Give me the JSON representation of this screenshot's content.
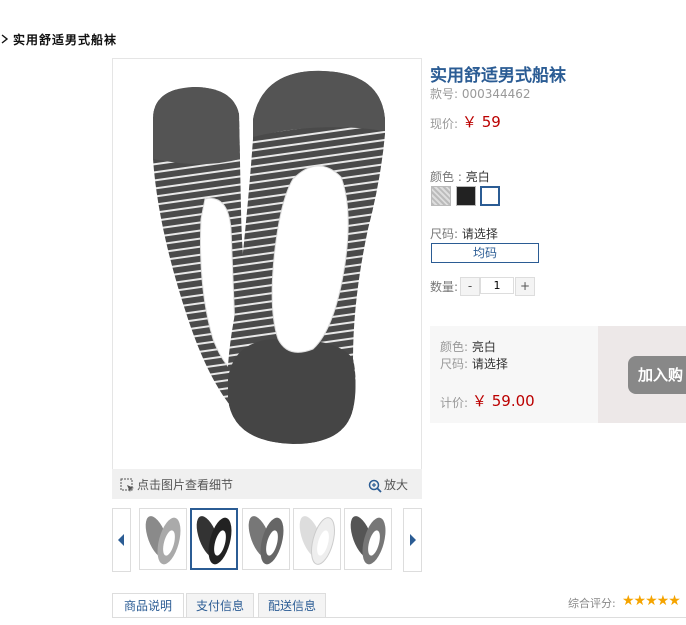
{
  "breadcrumb": {
    "title": "实用舒适男式船袜"
  },
  "gallery": {
    "detail_hint": "点击图片查看细节",
    "zoom_label": "放大",
    "thumbnails": [
      "thumb-1",
      "thumb-2",
      "thumb-3",
      "thumb-4",
      "thumb-5"
    ],
    "selected_thumbnail": 2
  },
  "product": {
    "title": "实用舒适男式船袜",
    "sku": "款号: 000344462",
    "price_label": "现价:",
    "price": "￥ 59",
    "color_label": "颜色 :",
    "color_value": "亮白",
    "colors": [
      "#bdbdbd",
      "#222222",
      "#ffffff"
    ],
    "size_label": "尺码:",
    "size_value": "请选择",
    "size_option": "均码",
    "qty_label": "数量:",
    "qty_minus": "-",
    "qty_value": "1",
    "qty_plus": "+"
  },
  "summary": {
    "color_label": "颜色:",
    "color_value": "亮白",
    "size_label": "尺码:",
    "size_value": "请选择",
    "total_label": "计价:",
    "total": "￥ 59.00",
    "add_to_cart": "加入购"
  },
  "tabs": [
    "商品说明",
    "支付信息",
    "配送信息"
  ],
  "rating": {
    "label": "综合评分:",
    "stars": "★★★★★"
  },
  "colors": {
    "accent": "#2b5c94",
    "price": "#bb0000"
  }
}
